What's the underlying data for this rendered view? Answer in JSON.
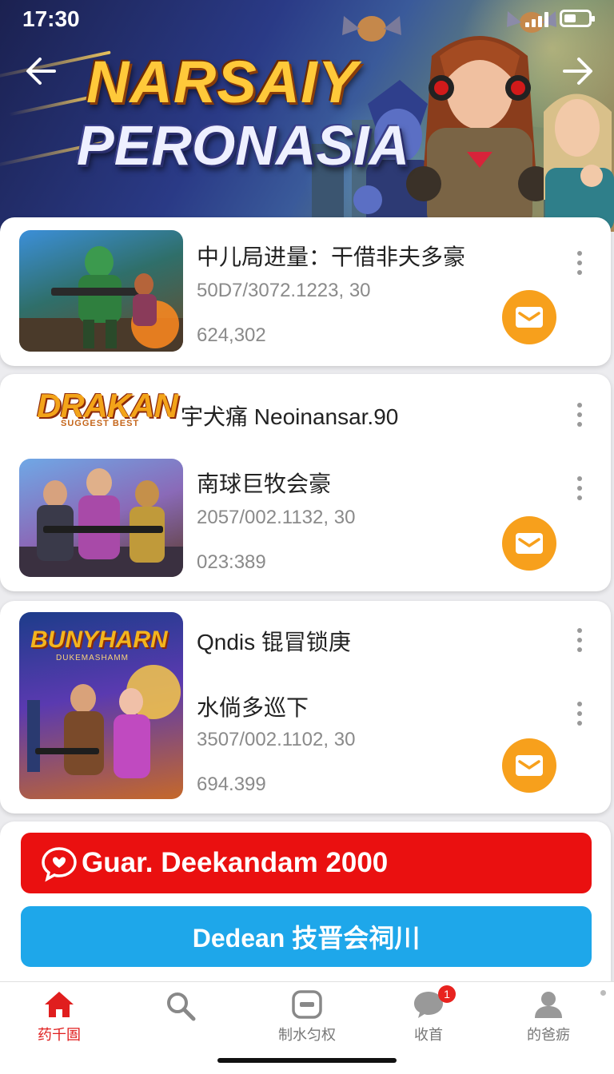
{
  "status_bar": {
    "time": "17:30"
  },
  "banner": {
    "title_line1": "NARSAIY",
    "title_line2": "PERONASIA"
  },
  "cards": [
    {
      "title": "中儿局进量：干借非夫多豪",
      "meta": "50D7/3072.1223, 30",
      "count": "624,302"
    },
    {
      "logo_text": "DRAKAN",
      "logo_sub": "SUGGEST BEST",
      "header_title": "宇犬痛 Neoinansar.90",
      "title": "南球巨牧会豪",
      "meta": "2057/002.1132, 30",
      "count": "023:389"
    },
    {
      "thumb_title": "BUNYHARN",
      "thumb_sub": "DUKEMASHAMM",
      "title": "Qndis 锟冒锁庚",
      "subtitle": "水倘多巡下",
      "meta": "3507/002.1102, 30",
      "count": "694.399"
    }
  ],
  "buttons": {
    "red_label": "Guar. Deekandam 2000",
    "blue_label": "Dedean 技晋会祠川"
  },
  "tabbar": {
    "items": [
      {
        "label": "药千圄",
        "icon": "home-icon",
        "active": true
      },
      {
        "label": "",
        "icon": "search-icon",
        "active": false
      },
      {
        "label": "制水匀权",
        "icon": "minus-box-icon",
        "active": false
      },
      {
        "label": "收首",
        "icon": "chat-bubble-icon",
        "active": false,
        "badge": "1"
      },
      {
        "label": "的爸疬",
        "icon": "person-icon",
        "active": false
      }
    ]
  },
  "colors": {
    "accent_orange": "#f7a01c",
    "red": "#ea1010",
    "blue": "#1ea7ea",
    "active_tab": "#e01e1e"
  }
}
